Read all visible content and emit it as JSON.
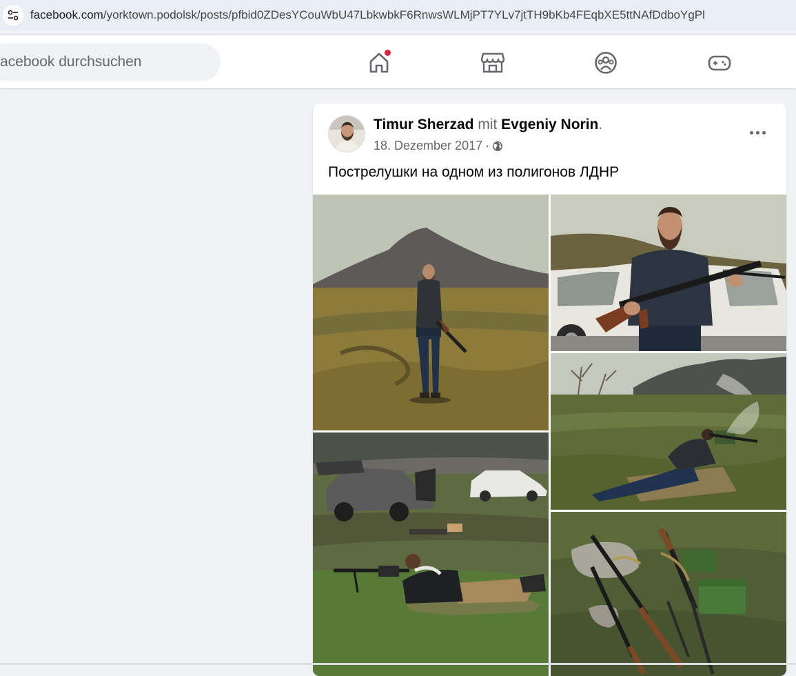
{
  "browser": {
    "url_host": "facebook.com",
    "url_path": "/yorktown.podolsk/posts/pfbid0ZDesYCouWbU47LbkwbkF6RnwsWLMjPT7YLv7jtTH9bKb4FEqbXE5ttNAfDdboYgPl"
  },
  "header": {
    "search_placeholder": "acebook durchsuchen",
    "nav": [
      {
        "icon": "home-icon",
        "active": true,
        "has_notification": true
      },
      {
        "icon": "marketplace-icon"
      },
      {
        "icon": "groups-icon"
      },
      {
        "icon": "gaming-icon"
      }
    ],
    "badge_color": "#e41e3f"
  },
  "post": {
    "author": "Timur Sherzad",
    "with_word": "mit",
    "tagged": "Evgeniy Norin",
    "period": ".",
    "date": "18. Dezember 2017",
    "separator": "·",
    "privacy_icon": "globe-icon",
    "text": "Пострелушки на одном из полигонов ЛДНР",
    "photos": [
      {
        "name": "man-standing-field"
      },
      {
        "name": "man-with-gun-by-car"
      },
      {
        "name": "man-prone-shooting"
      },
      {
        "name": "cars-and-man-prone"
      },
      {
        "name": "weapons-on-ground"
      }
    ]
  }
}
